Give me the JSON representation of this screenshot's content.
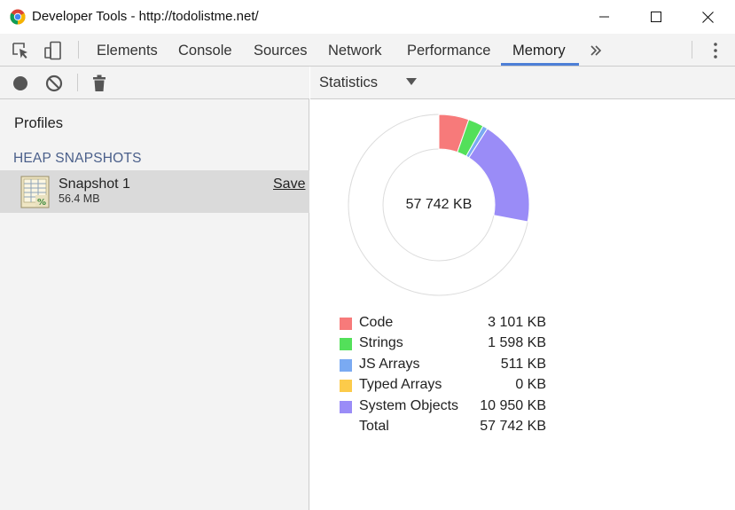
{
  "window": {
    "title": "Developer Tools - http://todolistme.net/"
  },
  "tabs": [
    {
      "label": "Elements",
      "active": false
    },
    {
      "label": "Console",
      "active": false
    },
    {
      "label": "Sources",
      "active": false
    },
    {
      "label": "Network",
      "active": false
    },
    {
      "label": "Performance",
      "active": false
    },
    {
      "label": "Memory",
      "active": true
    }
  ],
  "left_panel": {
    "profiles_title": "Profiles",
    "section_header": "HEAP SNAPSHOTS",
    "snapshot": {
      "name": "Snapshot 1",
      "size": "56.4 MB",
      "save_label": "Save"
    }
  },
  "right_panel": {
    "view_select": "Statistics",
    "total_center": "57 742 KB",
    "legend": [
      {
        "label": "Code",
        "value": "3 101 KB",
        "color": "#f77a7a"
      },
      {
        "label": "Strings",
        "value": "1 598 KB",
        "color": "#53e05a"
      },
      {
        "label": "JS Arrays",
        "value": "511 KB",
        "color": "#7aaaf2"
      },
      {
        "label": "Typed Arrays",
        "value": "0 KB",
        "color": "#fccb4a"
      },
      {
        "label": "System Objects",
        "value": "10 950 KB",
        "color": "#9a8cf7"
      },
      {
        "label": "Total",
        "value": "57 742 KB",
        "color": null
      }
    ]
  },
  "chart_data": {
    "type": "pie",
    "categories": [
      "Code",
      "Strings",
      "JS Arrays",
      "Typed Arrays",
      "System Objects"
    ],
    "values": [
      3101,
      1598,
      511,
      0,
      10950
    ],
    "total": 57742,
    "colors": [
      "#f77a7a",
      "#53e05a",
      "#7aaaf2",
      "#fccb4a",
      "#9a8cf7"
    ],
    "remainder_color": "#ffffff",
    "center_text": "57 742 KB"
  },
  "colors": {
    "accent": "#4d7fd7",
    "toolbar_bg": "#f3f3f3",
    "selected_row_bg": "#dadada",
    "section_header": "#4a5f8a"
  },
  "icons": {
    "inspect": "inspect-element-icon",
    "device": "device-toolbar-icon",
    "more_tabs": "chevron-double-right-icon",
    "menu": "kebab-menu-icon",
    "record": "record-icon",
    "clear": "clear-icon",
    "trash": "trash-icon",
    "snapshot": "heap-snapshot-icon"
  }
}
